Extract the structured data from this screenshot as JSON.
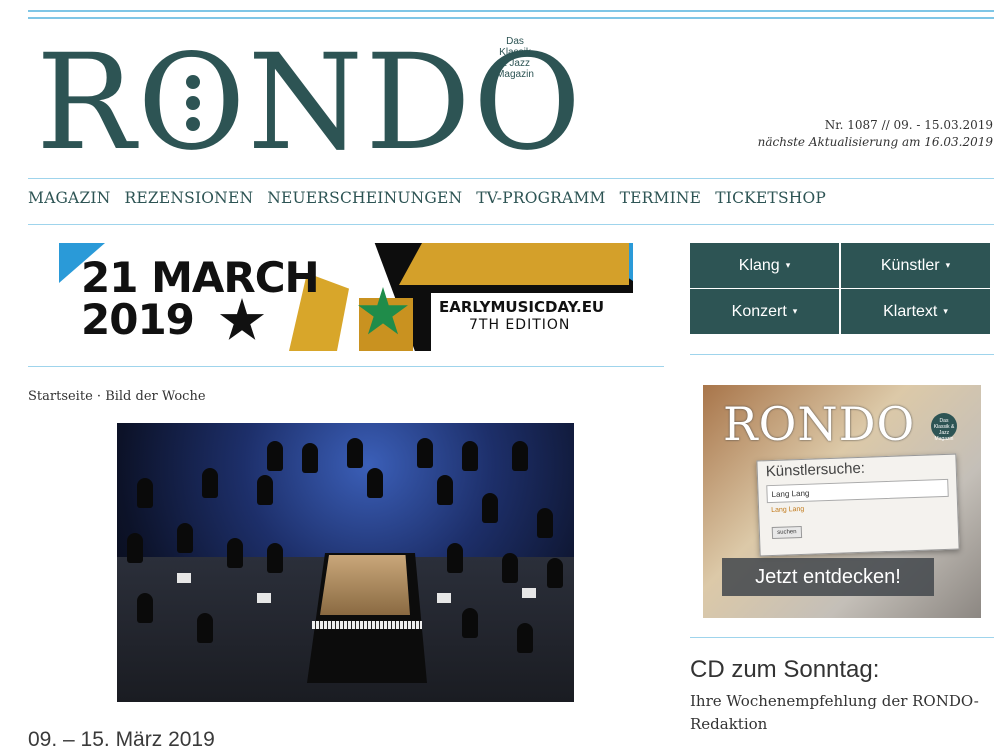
{
  "header": {
    "logo_text": "RONDO",
    "logo_tagline": "Das\nKlassik\n& Jazz\nMagazin",
    "issue_line": "Nr. 1087 // 09. - 15.03.2019",
    "next_update": "nächste Aktualisierung am 16.03.2019"
  },
  "nav": {
    "items": [
      "MAGAZIN",
      "REZENSIONEN",
      "NEUERSCHEINUNGEN",
      "TV-PROGRAMM",
      "TERMINE",
      "TICKETSHOP"
    ]
  },
  "banner": {
    "date_line1": "21 MARCH",
    "date_line2": "2019",
    "site": "EARLYMUSICDAY.EU",
    "edition": "7TH EDITION"
  },
  "category_menu": {
    "items": [
      "Klang",
      "Künstler",
      "Konzert",
      "Klartext"
    ],
    "caret": "▾"
  },
  "breadcrumb": {
    "home": "Startseite",
    "separator": "·",
    "current": "Bild der Woche"
  },
  "main": {
    "week_title": "09. – 15. März 2019"
  },
  "promo": {
    "logo_text": "RONDO",
    "logo_tagline": "Das Klassik & Jazz Magazin",
    "search_title": "Künstlersuche:",
    "search_value": "Lang Lang",
    "suggestion": "Lang Lang",
    "search_button": "suchen",
    "cta": "Jetzt entdecken!"
  },
  "sidebar": {
    "cd_title": "CD zum Sonntag:",
    "cd_desc": "Ihre Wochenempfehlung der RONDO-Redaktion"
  },
  "colors": {
    "brand": "#2d5454",
    "accent_line": "#7fc6e6",
    "cta_bg": "#464a4e"
  }
}
